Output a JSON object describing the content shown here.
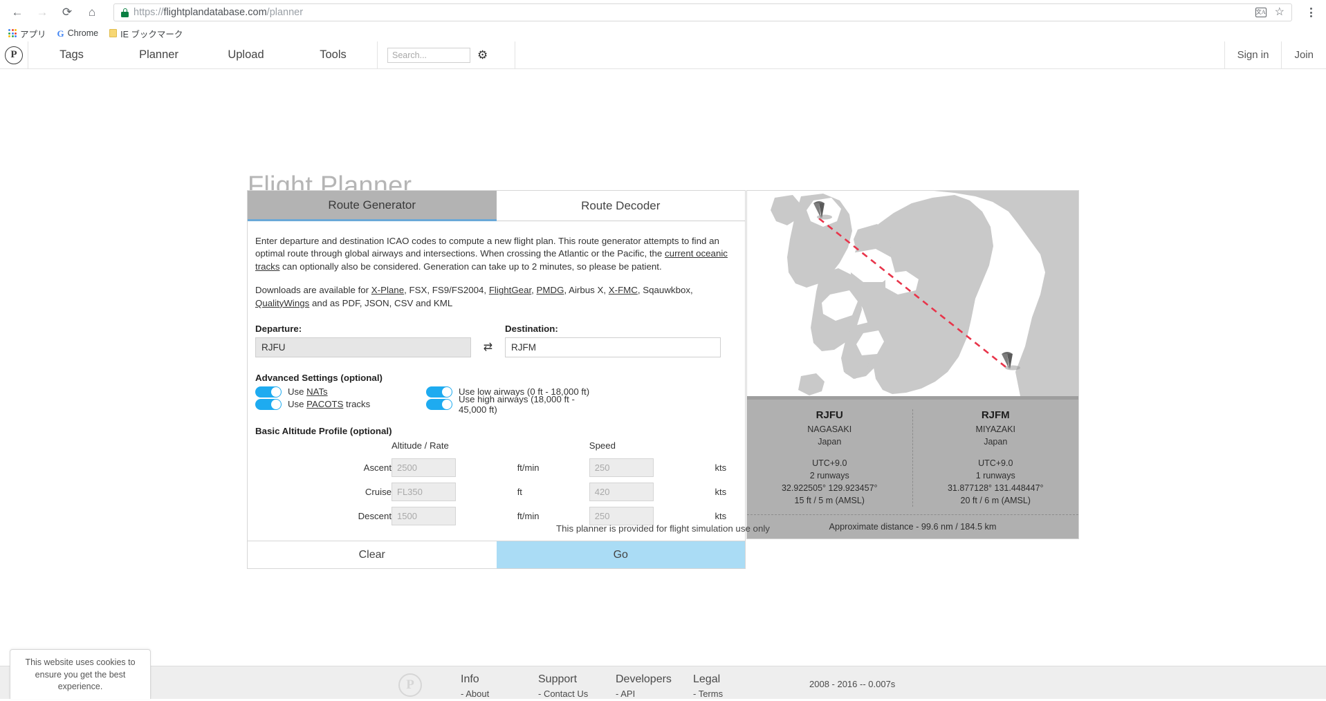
{
  "browser": {
    "back_icon": "←",
    "forward_icon": "→",
    "reload_icon": "⟳",
    "home_icon": "⌂",
    "url_scheme": "https://",
    "url_domain": "flightplandatabase.com",
    "url_path": "/planner",
    "translate_icon_label": "文A",
    "star_icon": "☆",
    "bookmarks": [
      {
        "label": "アプリ",
        "icon": "apps-grid-icon"
      },
      {
        "label": "Chrome",
        "icon": "google-g-icon"
      },
      {
        "label": "IE ブックマーク",
        "icon": "folder-icon"
      }
    ]
  },
  "topnav": {
    "logo_text": "P",
    "links": [
      "Tags",
      "Planner",
      "Upload",
      "Tools"
    ],
    "search_placeholder": "Search...",
    "search_value": "",
    "gear_icon": "⚙",
    "sign_in": "Sign in",
    "join": "Join"
  },
  "page": {
    "title": "Flight Planner",
    "disclaimer": "This planner is provided for flight simulation use only"
  },
  "tabs": [
    {
      "label": "Route Generator",
      "active": true
    },
    {
      "label": "Route Decoder",
      "active": false
    }
  ],
  "intro": {
    "p1_a": "Enter departure and destination ICAO codes to compute a new flight plan. This route generator attempts to find an optimal route through global airways and intersections. When crossing the Atlantic or the Pacific, the ",
    "p1_link": "current oceanic tracks",
    "p1_b": " can optionally also be considered. Generation can take up to 2 minutes, so please be patient.",
    "p2_a": "Downloads are available for ",
    "p2_links": [
      "X-Plane",
      "FlightGear",
      "PMDG",
      "X-FMC",
      "QualityWings"
    ],
    "p2_plain": [
      "FSX",
      "FS9/FS2004",
      "Airbus X",
      "Sqauwkbox"
    ],
    "p2_tail": " and as PDF, JSON, CSV and KML"
  },
  "form": {
    "departure_label": "Departure:",
    "departure_value": "RJFU",
    "destination_label": "Destination:",
    "destination_value": "RJFM",
    "swap_icon": "⇄",
    "advanced_heading": "Advanced Settings (optional)",
    "toggles": [
      {
        "label_pre": "Use ",
        "label_link": "NATs",
        "label_post": "",
        "on": true
      },
      {
        "label_pre": "Use ",
        "label_link": "PACOTS",
        "label_post": " tracks",
        "on": true
      },
      {
        "label_pre": "Use low airways (0 ft - 18,000 ft)",
        "label_link": "",
        "label_post": "",
        "on": true
      },
      {
        "label_pre": "Use high airways (18,000 ft - 45,000 ft)",
        "label_link": "",
        "label_post": "",
        "on": true
      }
    ],
    "altitude_heading": "Basic Altitude Profile (optional)",
    "col_altitude": "Altitude / Rate",
    "col_speed": "Speed",
    "rows": [
      {
        "name": "Ascent",
        "alt_placeholder": "2500",
        "alt_unit": "ft/min",
        "spd_placeholder": "250",
        "spd_unit": "kts"
      },
      {
        "name": "Cruise",
        "alt_placeholder": "FL350",
        "alt_unit": "ft",
        "spd_placeholder": "420",
        "spd_unit": "kts"
      },
      {
        "name": "Descent",
        "alt_placeholder": "1500",
        "alt_unit": "ft/min",
        "spd_placeholder": "250",
        "spd_unit": "kts"
      }
    ],
    "clear_label": "Clear",
    "go_label": "Go"
  },
  "map": {
    "land_color": "#c9c9c9",
    "water_color": "#ffffff",
    "route_color": "#e8344a",
    "marker_color": "#6e6e6e"
  },
  "airports": {
    "departure": {
      "icao": "RJFU",
      "city": "NAGASAKI",
      "country": "Japan",
      "utc": "UTC+9.0",
      "runways": "2 runways",
      "coords": "32.922505° 129.923457°",
      "elevation": "15 ft / 5 m (AMSL)"
    },
    "destination": {
      "icao": "RJFM",
      "city": "MIYAZAKI",
      "country": "Japan",
      "utc": "UTC+9.0",
      "runways": "1 runways",
      "coords": "31.877128° 131.448447°",
      "elevation": "20 ft / 6 m (AMSL)"
    },
    "distance": "Approximate distance - 99.6 nm / 184.5 km"
  },
  "footer": {
    "logo_text": "P",
    "columns": [
      {
        "title": "Info",
        "links": [
          "- About"
        ]
      },
      {
        "title": "Support",
        "links": [
          "- Contact Us"
        ]
      },
      {
        "title": "Developers",
        "links": [
          "- API"
        ]
      },
      {
        "title": "Legal",
        "links": [
          "- Terms"
        ]
      }
    ],
    "copyright": "2008 - 2016 -- 0.007s"
  },
  "cookie": {
    "text": "This website uses cookies to ensure you get the best experience."
  }
}
